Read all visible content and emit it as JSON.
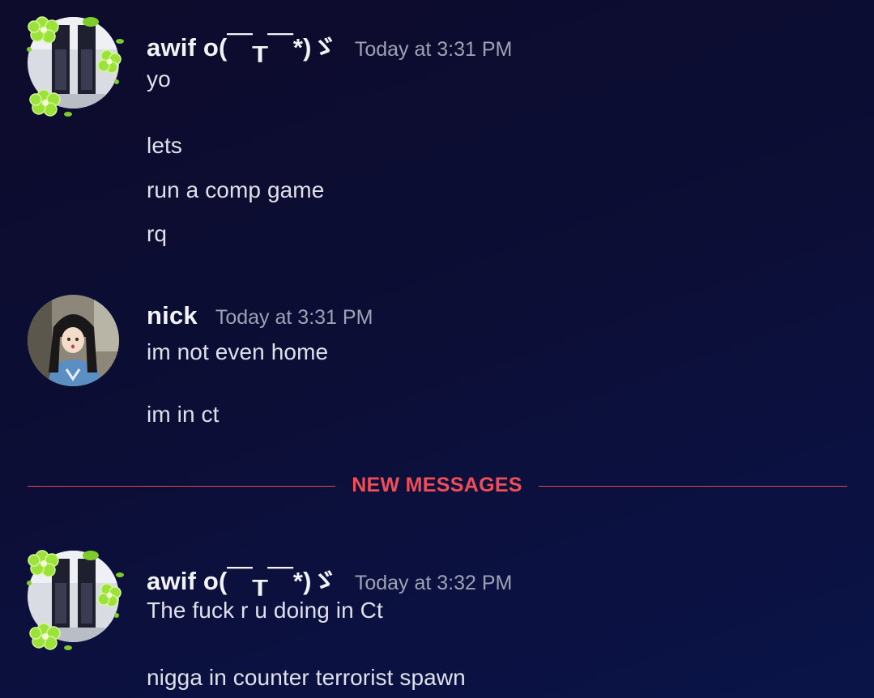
{
  "messages": [
    {
      "username": "awif o(￣┰￣*)ゞ",
      "timestamp": "Today at 3:31 PM",
      "avatar_icon": "user-avatar-with-flower-decoration",
      "lines": [
        "yo",
        "lets",
        "run a comp game",
        "rq"
      ]
    },
    {
      "username": "nick",
      "timestamp": "Today at 3:31 PM",
      "avatar_icon": "anime-girl-avatar",
      "lines": [
        "im not even home",
        "im in ct"
      ]
    },
    {
      "username": "awif o(￣┰￣*)ゞ",
      "timestamp": "Today at 3:32 PM",
      "avatar_icon": "user-avatar-with-flower-decoration",
      "lines": [
        "The fuck r u doing in Ct",
        "nigga in counter terrorist spawn"
      ]
    }
  ],
  "divider": {
    "label": "NEW MESSAGES",
    "color": "#ef4d57"
  },
  "colors": {
    "background": "#0c0d33",
    "username": "#f2f3f5",
    "timestamp": "#9ea2b3",
    "message_text": "#dfe1ea"
  }
}
